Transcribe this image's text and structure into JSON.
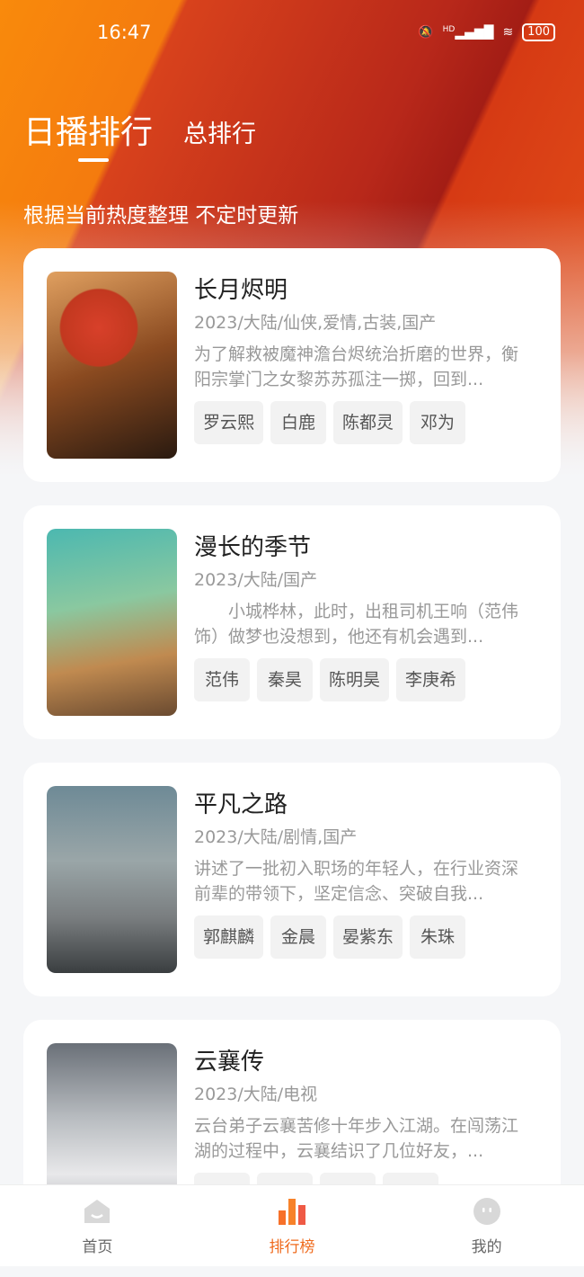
{
  "status": {
    "time": "16:47",
    "network": "HD",
    "battery": "100"
  },
  "header": {
    "tabs": [
      {
        "label": "日播排行",
        "active": true
      },
      {
        "label": "总排行",
        "active": false
      }
    ],
    "subtitle": "根据当前热度整理 不定时更新"
  },
  "colors": {
    "accent": "#ef6b1e",
    "header_orange": "#f98a0c",
    "header_red": "#a31d15"
  },
  "items": [
    {
      "title": "长月烬明",
      "meta": "2023/大陆/仙侠,爱情,古装,国产",
      "desc": "为了解救被魔神澹台烬统治折磨的世界，衡阳宗掌门之女黎苏苏孤注一掷，回到...",
      "tags": [
        "罗云熙",
        "白鹿",
        "陈都灵",
        "邓为"
      ]
    },
    {
      "title": "漫长的季节",
      "meta": "2023/大陆/国产",
      "desc": "　　小城桦林，此时，出租司机王响（范伟 饰）做梦也没想到，他还有机会遇到...",
      "tags": [
        "范伟",
        "秦昊",
        "陈明昊",
        "李庚希"
      ]
    },
    {
      "title": "平凡之路",
      "meta": "2023/大陆/剧情,国产",
      "desc": "讲述了一批初入职场的年轻人，在行业资深前辈的带领下，坚定信念、突破自我...",
      "tags": [
        "郭麒麟",
        "金晨",
        "晏紫东",
        "朱珠"
      ]
    },
    {
      "title": "云襄传",
      "meta": "2023/大陆/电视",
      "desc": "云台弟子云襄苦修十年步入江湖。在闯荡江湖的过程中，云襄结识了几位好友，...",
      "tags": []
    }
  ],
  "nav": [
    {
      "label": "首页",
      "icon": "home-icon"
    },
    {
      "label": "排行榜",
      "icon": "ranking-icon",
      "active": true
    },
    {
      "label": "我的",
      "icon": "profile-icon"
    }
  ]
}
